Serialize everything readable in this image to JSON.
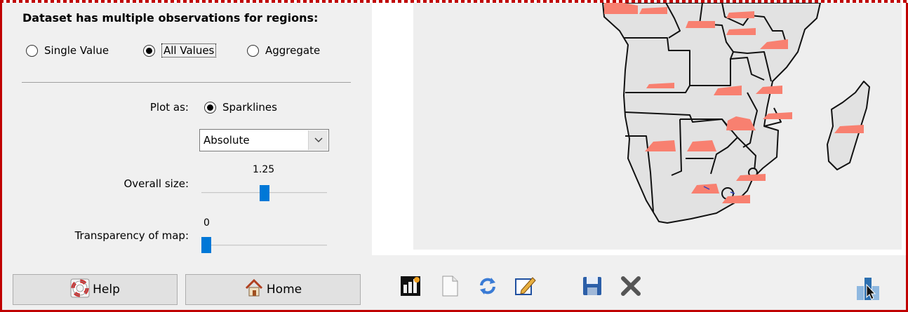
{
  "observations": {
    "heading": "Dataset has multiple observations for regions:",
    "options": [
      {
        "label": "Single Value",
        "checked": false
      },
      {
        "label": "All Values",
        "checked": true
      },
      {
        "label": "Aggregate",
        "checked": false
      }
    ]
  },
  "plot": {
    "label": "Plot as:",
    "sparklines_label": "Sparklines",
    "sparklines_checked": true,
    "mode_selected": "Absolute"
  },
  "overall_size": {
    "label": "Overall size:",
    "value": "1.25",
    "fraction": 0.5
  },
  "transparency": {
    "label": "Transparency of map:",
    "value": "0",
    "fraction": 0.0
  },
  "buttons": {
    "help": "Help",
    "home": "Home"
  },
  "toolbar_icons": [
    "chart-icon",
    "new-document-icon",
    "refresh-icon",
    "edit-icon",
    "save-icon",
    "close-icon"
  ],
  "corner_icon": "pointer-cursor-icon",
  "colors": {
    "frame": "#c00000",
    "panel": "#f0f0f0",
    "map_background": "#eeeeee",
    "land": "#e0e0e0",
    "sparkline": "#f88070",
    "slider_thumb": "#0078d7"
  }
}
